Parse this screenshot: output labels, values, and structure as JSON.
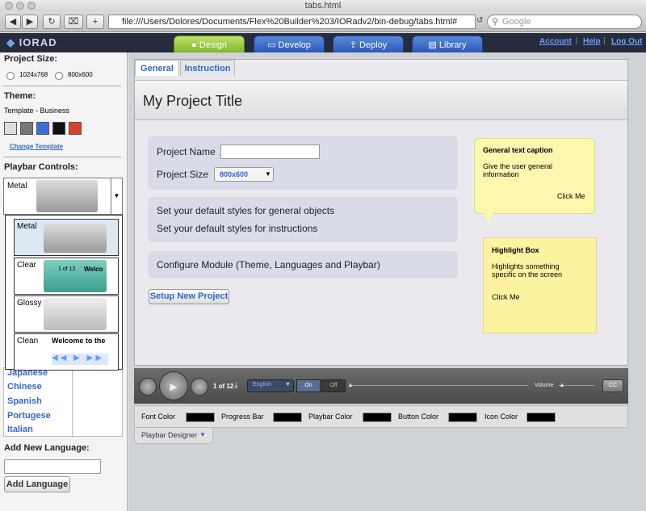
{
  "browser": {
    "window_title": "tabs.html",
    "url": "file:///Users/Dolores/Documents/Flex%20Builder%203/IORadv2/bin-debug/tabs.html#",
    "search_placeholder": "Google",
    "add_tab_label": "+"
  },
  "app": {
    "logo": "IORAD",
    "top_tabs": [
      {
        "label": "Design"
      },
      {
        "label": "Develop"
      },
      {
        "label": "Deploy"
      },
      {
        "label": "Library"
      }
    ],
    "links": {
      "account": "Account",
      "help": "Help",
      "logout": "Log Out"
    }
  },
  "sidebar": {
    "project_size_label": "Project Size:",
    "size_options": [
      "1024x768",
      "800x600"
    ],
    "theme_label": "Theme:",
    "template_name": "Template - Business",
    "swatch_colors": [
      "#dddddd",
      "#777777",
      "#3a6fd8",
      "#111111",
      "#d9412d"
    ],
    "change_template": "Change Template",
    "playbar_controls_label": "Playbar Controls:",
    "selected_playbar": "Metal",
    "playbar_options": [
      {
        "label": "Metal"
      },
      {
        "label": "Clear",
        "counter": "1 of 12",
        "text": "Welco"
      },
      {
        "label": "Glossy"
      },
      {
        "label": "Clean",
        "text": "Welcome to the"
      }
    ],
    "languages": [
      "Japanese",
      "Chinese",
      "Spanish",
      "Portugese",
      "Italian"
    ],
    "add_language_label": "Add New Language:",
    "add_language_button": "Add Language"
  },
  "canvas": {
    "tabs": [
      "General",
      "Instruction"
    ],
    "project_title": "My Project Title",
    "project_name_label": "Project Name",
    "project_name_value": "",
    "project_size_label": "Project Size",
    "project_size_value": "800x600",
    "styles_general": "Set your default styles for general objects",
    "styles_instructions": "Set your default styles for instructions",
    "configure_module": "Configure Module (Theme, Languages and Playbar)",
    "setup_button": "Setup New Project",
    "caption": {
      "title": "General text caption",
      "body": "Give the user general information",
      "click": "Click Me"
    },
    "highlight": {
      "title": "Highlight Box",
      "body": "Highlights something specific on the screen",
      "click": "Click Me"
    }
  },
  "playbar": {
    "counter": "1 of 12",
    "language": "English",
    "on": "On",
    "off": "Off",
    "volume": "Volume",
    "cc": "CC"
  },
  "style_controls": {
    "items": [
      "Font Color",
      "Progress Bar",
      "Playbar Color",
      "Button Color",
      "Icon Color"
    ],
    "designer_tab": "Playbar Designer"
  }
}
